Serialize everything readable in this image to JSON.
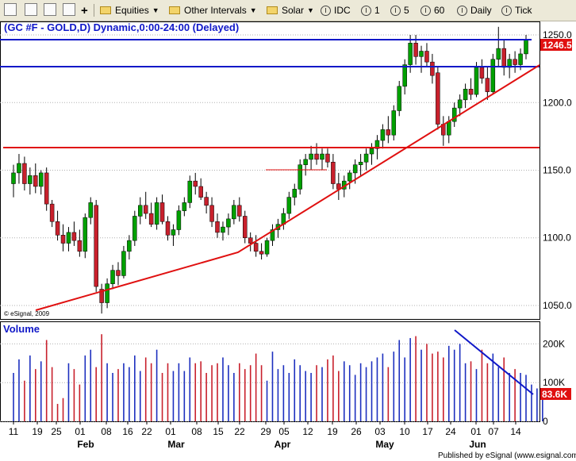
{
  "toolbar": {
    "equities": "Equities",
    "other_intervals": "Other Intervals",
    "solar": "Solar",
    "symbol_idc": "IDC",
    "interval_1": "1",
    "interval_5": "5",
    "interval_60": "60",
    "daily": "Daily",
    "tick": "Tick",
    "info_glyph": "I",
    "add_glyph": "+"
  },
  "chart": {
    "title": "(GC #F - GOLD,D) Dynamic,0:00-24:00 (Delayed)",
    "last_price": "1246.5",
    "volume_label": "Volume",
    "last_volume": "83.6K",
    "watermark": "© eSignal, 2009",
    "footer": "Published by eSignal (www.esignal.com)"
  },
  "colors": {
    "up": "#00a000",
    "down": "#c8202c",
    "vol_up": "#1c2fbf",
    "vol_down": "#c8202c",
    "trend_red": "#e01010",
    "resistance_blue": "#1018c8",
    "price_tag_bg": "#e01010",
    "title_color": "#1018c8"
  },
  "icons": [
    "toolbar-tool-icon",
    "toolbar-chart-icon",
    "toolbar-cursor-icon",
    "toolbar-properties-icon",
    "toolbar-add-icon",
    "folder-icon",
    "info-circle-icon"
  ],
  "chart_data": {
    "type": "candlestick",
    "y_ticks": [
      1050,
      1100,
      1150,
      1200,
      1250
    ],
    "y_tick_labels": [
      "1050.0",
      "1100.0",
      "1150.0",
      "1200.0",
      "1250.0"
    ],
    "ylim": [
      1040,
      1260
    ],
    "volume_ticks": [
      0,
      100000,
      200000
    ],
    "volume_tick_labels": [
      "0",
      "100K",
      "200K"
    ],
    "volume_lim": [
      0,
      250000
    ],
    "x_tick_labels": [
      "11",
      "19",
      "25",
      "01",
      "08",
      "16",
      "22",
      "01",
      "08",
      "15",
      "22",
      "29",
      "05",
      "12",
      "19",
      "26",
      "03",
      "10",
      "17",
      "24",
      "01",
      "07",
      "14"
    ],
    "month_labels": [
      "Feb",
      "Mar",
      "Apr",
      "May",
      "Jun"
    ],
    "candles": [
      {
        "o": 1140,
        "h": 1154,
        "l": 1130,
        "c": 1148
      },
      {
        "o": 1148,
        "h": 1162,
        "l": 1140,
        "c": 1155
      },
      {
        "o": 1155,
        "h": 1160,
        "l": 1135,
        "c": 1140
      },
      {
        "o": 1140,
        "h": 1152,
        "l": 1132,
        "c": 1146
      },
      {
        "o": 1146,
        "h": 1155,
        "l": 1133,
        "c": 1138
      },
      {
        "o": 1138,
        "h": 1150,
        "l": 1132,
        "c": 1148
      },
      {
        "o": 1148,
        "h": 1152,
        "l": 1120,
        "c": 1125
      },
      {
        "o": 1125,
        "h": 1128,
        "l": 1108,
        "c": 1112
      },
      {
        "o": 1112,
        "h": 1120,
        "l": 1098,
        "c": 1102
      },
      {
        "o": 1102,
        "h": 1110,
        "l": 1090,
        "c": 1096
      },
      {
        "o": 1096,
        "h": 1108,
        "l": 1090,
        "c": 1104
      },
      {
        "o": 1104,
        "h": 1112,
        "l": 1094,
        "c": 1098
      },
      {
        "o": 1098,
        "h": 1106,
        "l": 1086,
        "c": 1090
      },
      {
        "o": 1090,
        "h": 1118,
        "l": 1085,
        "c": 1115
      },
      {
        "o": 1115,
        "h": 1130,
        "l": 1110,
        "c": 1126
      },
      {
        "o": 1124,
        "h": 1128,
        "l": 1060,
        "c": 1064
      },
      {
        "o": 1062,
        "h": 1066,
        "l": 1044,
        "c": 1052
      },
      {
        "o": 1052,
        "h": 1070,
        "l": 1048,
        "c": 1066
      },
      {
        "o": 1066,
        "h": 1080,
        "l": 1062,
        "c": 1076
      },
      {
        "o": 1076,
        "h": 1082,
        "l": 1065,
        "c": 1072
      },
      {
        "o": 1072,
        "h": 1094,
        "l": 1070,
        "c": 1090
      },
      {
        "o": 1090,
        "h": 1102,
        "l": 1084,
        "c": 1098
      },
      {
        "o": 1098,
        "h": 1120,
        "l": 1094,
        "c": 1116
      },
      {
        "o": 1116,
        "h": 1130,
        "l": 1110,
        "c": 1124
      },
      {
        "o": 1124,
        "h": 1134,
        "l": 1114,
        "c": 1118
      },
      {
        "o": 1118,
        "h": 1126,
        "l": 1108,
        "c": 1110
      },
      {
        "o": 1110,
        "h": 1130,
        "l": 1106,
        "c": 1126
      },
      {
        "o": 1126,
        "h": 1132,
        "l": 1110,
        "c": 1112
      },
      {
        "o": 1112,
        "h": 1116,
        "l": 1098,
        "c": 1102
      },
      {
        "o": 1102,
        "h": 1110,
        "l": 1094,
        "c": 1106
      },
      {
        "o": 1106,
        "h": 1124,
        "l": 1102,
        "c": 1120
      },
      {
        "o": 1120,
        "h": 1130,
        "l": 1116,
        "c": 1126
      },
      {
        "o": 1126,
        "h": 1146,
        "l": 1122,
        "c": 1142
      },
      {
        "o": 1142,
        "h": 1148,
        "l": 1132,
        "c": 1138
      },
      {
        "o": 1138,
        "h": 1144,
        "l": 1128,
        "c": 1130
      },
      {
        "o": 1130,
        "h": 1134,
        "l": 1118,
        "c": 1124
      },
      {
        "o": 1124,
        "h": 1130,
        "l": 1108,
        "c": 1112
      },
      {
        "o": 1112,
        "h": 1118,
        "l": 1100,
        "c": 1104
      },
      {
        "o": 1104,
        "h": 1112,
        "l": 1098,
        "c": 1108
      },
      {
        "o": 1108,
        "h": 1118,
        "l": 1102,
        "c": 1114
      },
      {
        "o": 1114,
        "h": 1128,
        "l": 1110,
        "c": 1124
      },
      {
        "o": 1124,
        "h": 1130,
        "l": 1112,
        "c": 1116
      },
      {
        "o": 1116,
        "h": 1120,
        "l": 1096,
        "c": 1100
      },
      {
        "o": 1100,
        "h": 1104,
        "l": 1090,
        "c": 1096
      },
      {
        "o": 1096,
        "h": 1102,
        "l": 1086,
        "c": 1090
      },
      {
        "o": 1090,
        "h": 1096,
        "l": 1084,
        "c": 1088
      },
      {
        "o": 1088,
        "h": 1100,
        "l": 1086,
        "c": 1098
      },
      {
        "o": 1098,
        "h": 1110,
        "l": 1094,
        "c": 1106
      },
      {
        "o": 1106,
        "h": 1114,
        "l": 1100,
        "c": 1110
      },
      {
        "o": 1110,
        "h": 1122,
        "l": 1106,
        "c": 1118
      },
      {
        "o": 1118,
        "h": 1134,
        "l": 1114,
        "c": 1130
      },
      {
        "o": 1130,
        "h": 1140,
        "l": 1124,
        "c": 1136
      },
      {
        "o": 1136,
        "h": 1158,
        "l": 1132,
        "c": 1154
      },
      {
        "o": 1154,
        "h": 1162,
        "l": 1146,
        "c": 1158
      },
      {
        "o": 1158,
        "h": 1168,
        "l": 1150,
        "c": 1162
      },
      {
        "o": 1162,
        "h": 1170,
        "l": 1154,
        "c": 1158
      },
      {
        "o": 1158,
        "h": 1166,
        "l": 1150,
        "c": 1162
      },
      {
        "o": 1162,
        "h": 1166,
        "l": 1152,
        "c": 1156
      },
      {
        "o": 1156,
        "h": 1162,
        "l": 1136,
        "c": 1140
      },
      {
        "o": 1140,
        "h": 1148,
        "l": 1128,
        "c": 1136
      },
      {
        "o": 1136,
        "h": 1146,
        "l": 1130,
        "c": 1142
      },
      {
        "o": 1142,
        "h": 1150,
        "l": 1136,
        "c": 1148
      },
      {
        "o": 1148,
        "h": 1158,
        "l": 1140,
        "c": 1154
      },
      {
        "o": 1154,
        "h": 1162,
        "l": 1146,
        "c": 1156
      },
      {
        "o": 1156,
        "h": 1166,
        "l": 1150,
        "c": 1162
      },
      {
        "o": 1162,
        "h": 1170,
        "l": 1154,
        "c": 1166
      },
      {
        "o": 1166,
        "h": 1176,
        "l": 1158,
        "c": 1172
      },
      {
        "o": 1172,
        "h": 1184,
        "l": 1166,
        "c": 1180
      },
      {
        "o": 1180,
        "h": 1190,
        "l": 1170,
        "c": 1176
      },
      {
        "o": 1176,
        "h": 1198,
        "l": 1172,
        "c": 1194
      },
      {
        "o": 1194,
        "h": 1216,
        "l": 1190,
        "c": 1212
      },
      {
        "o": 1212,
        "h": 1232,
        "l": 1206,
        "c": 1228
      },
      {
        "o": 1228,
        "h": 1250,
        "l": 1222,
        "c": 1244
      },
      {
        "o": 1244,
        "h": 1250,
        "l": 1228,
        "c": 1234
      },
      {
        "o": 1234,
        "h": 1242,
        "l": 1222,
        "c": 1238
      },
      {
        "o": 1238,
        "h": 1244,
        "l": 1226,
        "c": 1230
      },
      {
        "o": 1230,
        "h": 1236,
        "l": 1214,
        "c": 1220
      },
      {
        "o": 1222,
        "h": 1226,
        "l": 1180,
        "c": 1184
      },
      {
        "o": 1184,
        "h": 1190,
        "l": 1168,
        "c": 1176
      },
      {
        "o": 1176,
        "h": 1190,
        "l": 1170,
        "c": 1186
      },
      {
        "o": 1186,
        "h": 1200,
        "l": 1182,
        "c": 1196
      },
      {
        "o": 1196,
        "h": 1206,
        "l": 1190,
        "c": 1202
      },
      {
        "o": 1202,
        "h": 1214,
        "l": 1196,
        "c": 1210
      },
      {
        "o": 1210,
        "h": 1218,
        "l": 1202,
        "c": 1206
      },
      {
        "o": 1206,
        "h": 1230,
        "l": 1204,
        "c": 1226
      },
      {
        "o": 1226,
        "h": 1232,
        "l": 1214,
        "c": 1218
      },
      {
        "o": 1218,
        "h": 1226,
        "l": 1202,
        "c": 1208
      },
      {
        "o": 1208,
        "h": 1236,
        "l": 1206,
        "c": 1232
      },
      {
        "o": 1232,
        "h": 1256,
        "l": 1226,
        "c": 1240
      },
      {
        "o": 1240,
        "h": 1246,
        "l": 1220,
        "c": 1226
      },
      {
        "o": 1226,
        "h": 1236,
        "l": 1218,
        "c": 1232
      },
      {
        "o": 1232,
        "h": 1238,
        "l": 1222,
        "c": 1228
      },
      {
        "o": 1228,
        "h": 1240,
        "l": 1224,
        "c": 1236
      },
      {
        "o": 1236,
        "h": 1250,
        "l": 1232,
        "c": 1246.5
      }
    ],
    "volumes": [
      125000,
      160000,
      105000,
      170000,
      135000,
      155000,
      210000,
      140000,
      45000,
      60000,
      150000,
      135000,
      95000,
      170000,
      185000,
      140000,
      225000,
      150000,
      125000,
      135000,
      150000,
      140000,
      170000,
      130000,
      165000,
      150000,
      185000,
      125000,
      150000,
      130000,
      150000,
      130000,
      165000,
      150000,
      155000,
      125000,
      145000,
      150000,
      165000,
      145000,
      125000,
      150000,
      135000,
      145000,
      175000,
      145000,
      105000,
      180000,
      135000,
      145000,
      125000,
      160000,
      145000,
      130000,
      125000,
      145000,
      140000,
      160000,
      170000,
      130000,
      155000,
      145000,
      120000,
      150000,
      140000,
      155000,
      165000,
      175000,
      140000,
      180000,
      210000,
      165000,
      215000,
      220000,
      185000,
      200000,
      175000,
      180000,
      165000,
      195000,
      185000,
      200000,
      150000,
      155000,
      135000,
      185000,
      150000,
      175000,
      140000,
      165000,
      125000,
      135000,
      125000,
      120000,
      95000,
      85000,
      83600
    ]
  }
}
